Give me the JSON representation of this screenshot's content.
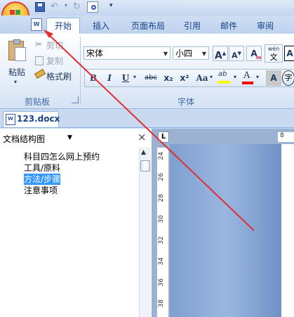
{
  "quick_access": {
    "dropdown_icon": "customize-quick-access-icon"
  },
  "ribbon_tabs": [
    "开始",
    "插入",
    "页面布局",
    "引用",
    "邮件",
    "审阅"
  ],
  "clipboard": {
    "paste_label": "粘贴",
    "cut_label": "剪切",
    "copy_label": "复制",
    "format_painter_label": "格式刷",
    "group_label": "剪贴板"
  },
  "font": {
    "font_name": "宋体",
    "font_size": "小四",
    "grow_label": "A",
    "shrink_label": "A",
    "clear_label": "A",
    "phonetic_label": "wén",
    "bold": "B",
    "italic": "I",
    "underline": "U",
    "strike": "abc",
    "subscript": "x₂",
    "superscript": "x²",
    "change_case": "Aa",
    "highlight": "ab",
    "font_color": "A",
    "char_shading": "A",
    "group_label": "字体"
  },
  "document_tab": {
    "filename": "123.docx"
  },
  "nav_pane": {
    "mode": "文档结构图",
    "close_label": "×",
    "items": [
      "科目四怎么网上预约",
      "工具/原料",
      "方法/步骤",
      "注意事项"
    ],
    "selected_index": 2
  },
  "ruler": {
    "vertical_ticks": [
      "24",
      "26",
      "28",
      "30",
      "32",
      "34",
      "36",
      "38"
    ],
    "horizontal_tick": "8",
    "tab_selector": "L"
  },
  "colors": {
    "annotation_red": "#e03030",
    "selection_blue": "#3399ff",
    "highlight_yellow": "#ffff00",
    "font_red": "#ff0000"
  }
}
